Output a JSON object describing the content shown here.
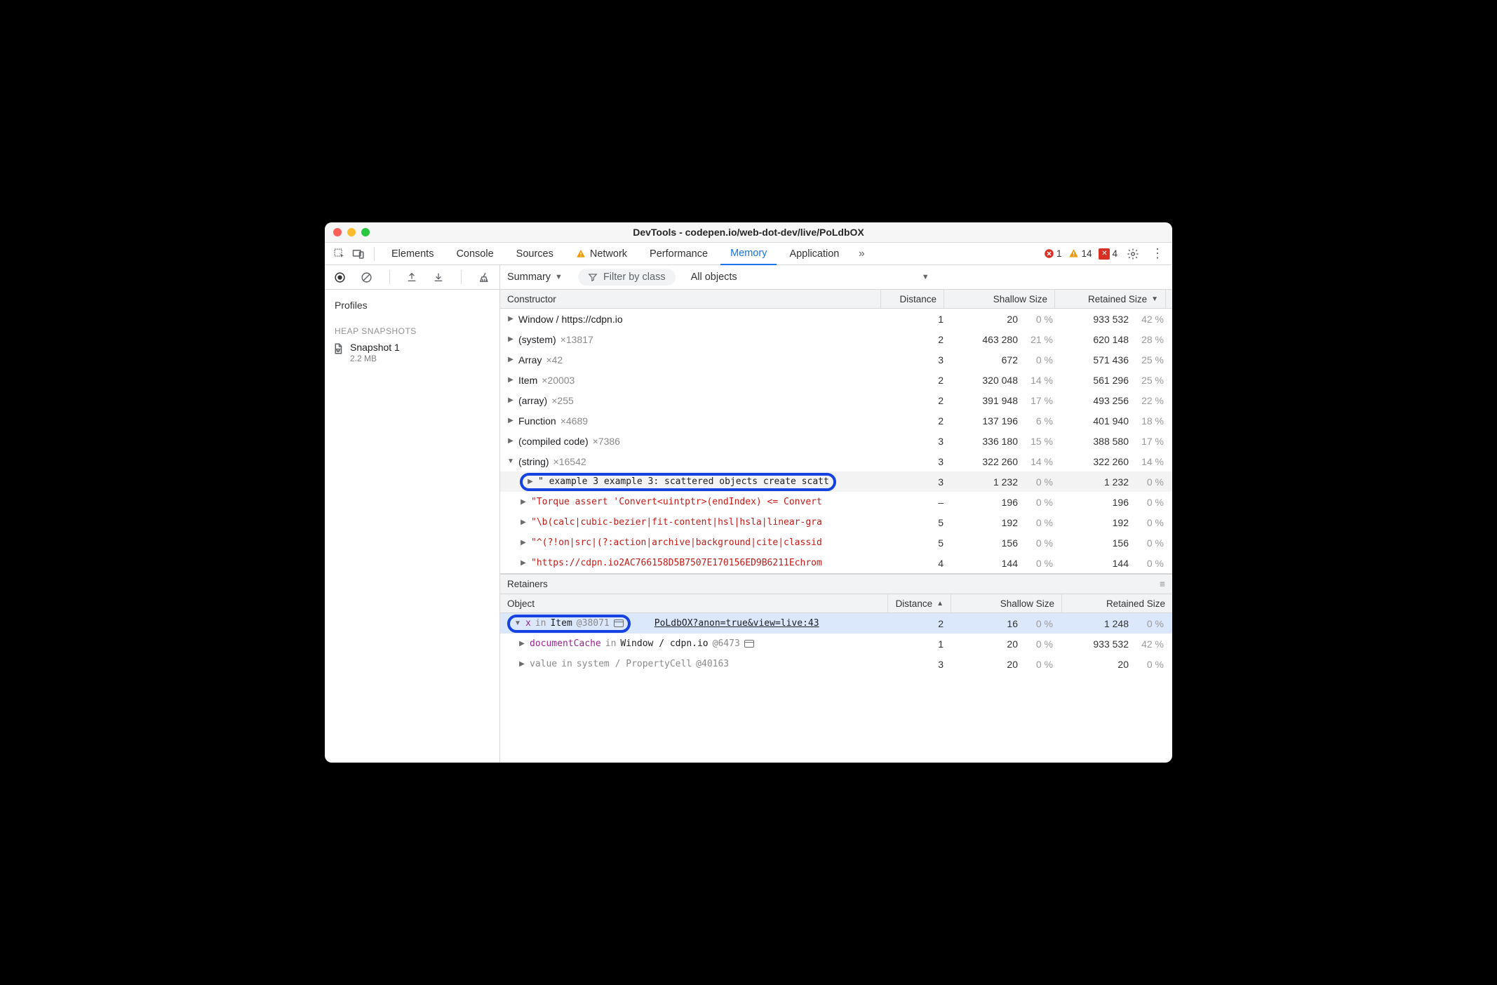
{
  "window": {
    "title": "DevTools - codepen.io/web-dot-dev/live/PoLdbOX"
  },
  "tabs": {
    "items": [
      "Elements",
      "Console",
      "Sources",
      "Network",
      "Performance",
      "Memory",
      "Application"
    ],
    "network_warn": true,
    "active": "Memory",
    "errors": "1",
    "warnings": "14",
    "blocked": "4"
  },
  "toolbar": {
    "summary_label": "Summary",
    "filter_placeholder": "Filter by class",
    "objects_label": "All objects"
  },
  "sidebar": {
    "profiles_label": "Profiles",
    "section_label": "HEAP SNAPSHOTS",
    "snapshot": {
      "name": "Snapshot 1",
      "size": "2.2 MB"
    }
  },
  "constructors": {
    "headers": {
      "c0": "Constructor",
      "c1": "Distance",
      "c2": "Shallow Size",
      "c3": "Retained Size"
    },
    "rows": [
      {
        "label": "Window / https://cdpn.io",
        "count": "",
        "dist": "1",
        "ss": "20",
        "ssp": "0 %",
        "rs": "933 532",
        "rsp": "42 %"
      },
      {
        "label": "(system)",
        "count": "×13817",
        "dist": "2",
        "ss": "463 280",
        "ssp": "21 %",
        "rs": "620 148",
        "rsp": "28 %"
      },
      {
        "label": "Array",
        "count": "×42",
        "dist": "3",
        "ss": "672",
        "ssp": "0 %",
        "rs": "571 436",
        "rsp": "25 %"
      },
      {
        "label": "Item",
        "count": "×20003",
        "dist": "2",
        "ss": "320 048",
        "ssp": "14 %",
        "rs": "561 296",
        "rsp": "25 %"
      },
      {
        "label": "(array)",
        "count": "×255",
        "dist": "2",
        "ss": "391 948",
        "ssp": "17 %",
        "rs": "493 256",
        "rsp": "22 %"
      },
      {
        "label": "Function",
        "count": "×4689",
        "dist": "2",
        "ss": "137 196",
        "ssp": "6 %",
        "rs": "401 940",
        "rsp": "18 %"
      },
      {
        "label": "(compiled code)",
        "count": "×7386",
        "dist": "3",
        "ss": "336 180",
        "ssp": "15 %",
        "rs": "388 580",
        "rsp": "17 %"
      },
      {
        "label": "(string)",
        "count": "×16542",
        "dist": "3",
        "ss": "322 260",
        "ssp": "14 %",
        "rs": "322 260",
        "rsp": "14 %",
        "expanded": true
      }
    ],
    "strings": [
      {
        "txt": "\" example 3 example 3: scattered objects create scatt",
        "dist": "3",
        "ss": "1 232",
        "ssp": "0 %",
        "rs": "1 232",
        "rsp": "0 %",
        "highlight": true,
        "selected": true
      },
      {
        "txt": "\"Torque assert 'Convert<uintptr>(endIndex) <= Convert",
        "dist": "–",
        "ss": "196",
        "ssp": "0 %",
        "rs": "196",
        "rsp": "0 %"
      },
      {
        "txt": "\"\\b(calc|cubic-bezier|fit-content|hsl|hsla|linear-gra",
        "dist": "5",
        "ss": "192",
        "ssp": "0 %",
        "rs": "192",
        "rsp": "0 %"
      },
      {
        "txt": "\"^(?!on|src|(?:action|archive|background|cite|classid",
        "dist": "5",
        "ss": "156",
        "ssp": "0 %",
        "rs": "156",
        "rsp": "0 %"
      },
      {
        "txt": "\"https://cdpn.io2AC766158D5B7507E170156ED9B6211Echrom",
        "dist": "4",
        "ss": "144",
        "ssp": "0 %",
        "rs": "144",
        "rsp": "0 %"
      }
    ]
  },
  "retainers": {
    "title": "Retainers",
    "headers": {
      "c0": "Object",
      "c1": "Distance",
      "c2": "Shallow Size",
      "c3": "Retained Size"
    },
    "rows": [
      {
        "prop": "x",
        "in": "in",
        "obj": "Item",
        "id": "@38071",
        "link": "PoLdbOX?anon=true&view=live:43",
        "dist": "2",
        "ss": "16",
        "ssp": "0 %",
        "rs": "1 248",
        "rsp": "0 %",
        "highlight": true,
        "expanded": true,
        "selected": true
      },
      {
        "prop": "documentCache",
        "in": "in",
        "obj": "Window / cdpn.io",
        "id": "@6473",
        "dist": "1",
        "ss": "20",
        "ssp": "0 %",
        "rs": "933 532",
        "rsp": "42 %",
        "tab_icon": true
      },
      {
        "prop": "value",
        "in": "in",
        "obj": "system / PropertyCell",
        "id": "@40163",
        "dist": "3",
        "ss": "20",
        "ssp": "0 %",
        "rs": "20",
        "rsp": "0 %",
        "grey": true
      }
    ]
  }
}
